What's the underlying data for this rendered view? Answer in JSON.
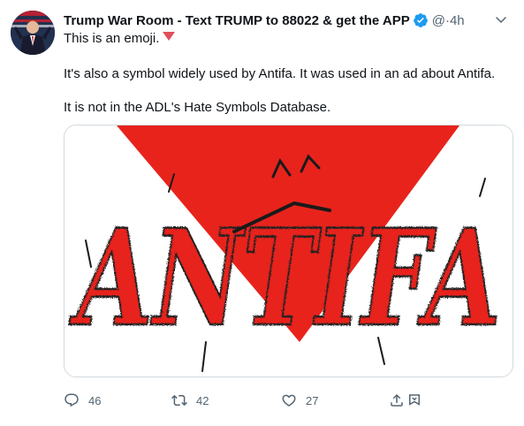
{
  "tweet": {
    "author_name": "Trump War Room - Text TRUMP to 88022 & get the APP",
    "handle": "@·",
    "time": "4h",
    "lines": [
      "This is an emoji.",
      "It's also a symbol widely used by Antifa. It was used in an ad about Antifa.",
      "It is not in the ADL's Hate Symbols Database."
    ],
    "image_text": "ANTIFA",
    "accent_color": "#e0505a",
    "image_red": "#e8231c",
    "verified_color": "#1d9bf0"
  },
  "actions": {
    "replies": "46",
    "retweets": "42",
    "likes": "27"
  },
  "icons": {
    "verified": "verified-badge-icon",
    "caret": "chevron-down-icon",
    "reply": "reply-icon",
    "retweet": "retweet-icon",
    "like": "heart-icon",
    "share": "share-icon",
    "emoji": "red-triangle-emoji-icon"
  }
}
